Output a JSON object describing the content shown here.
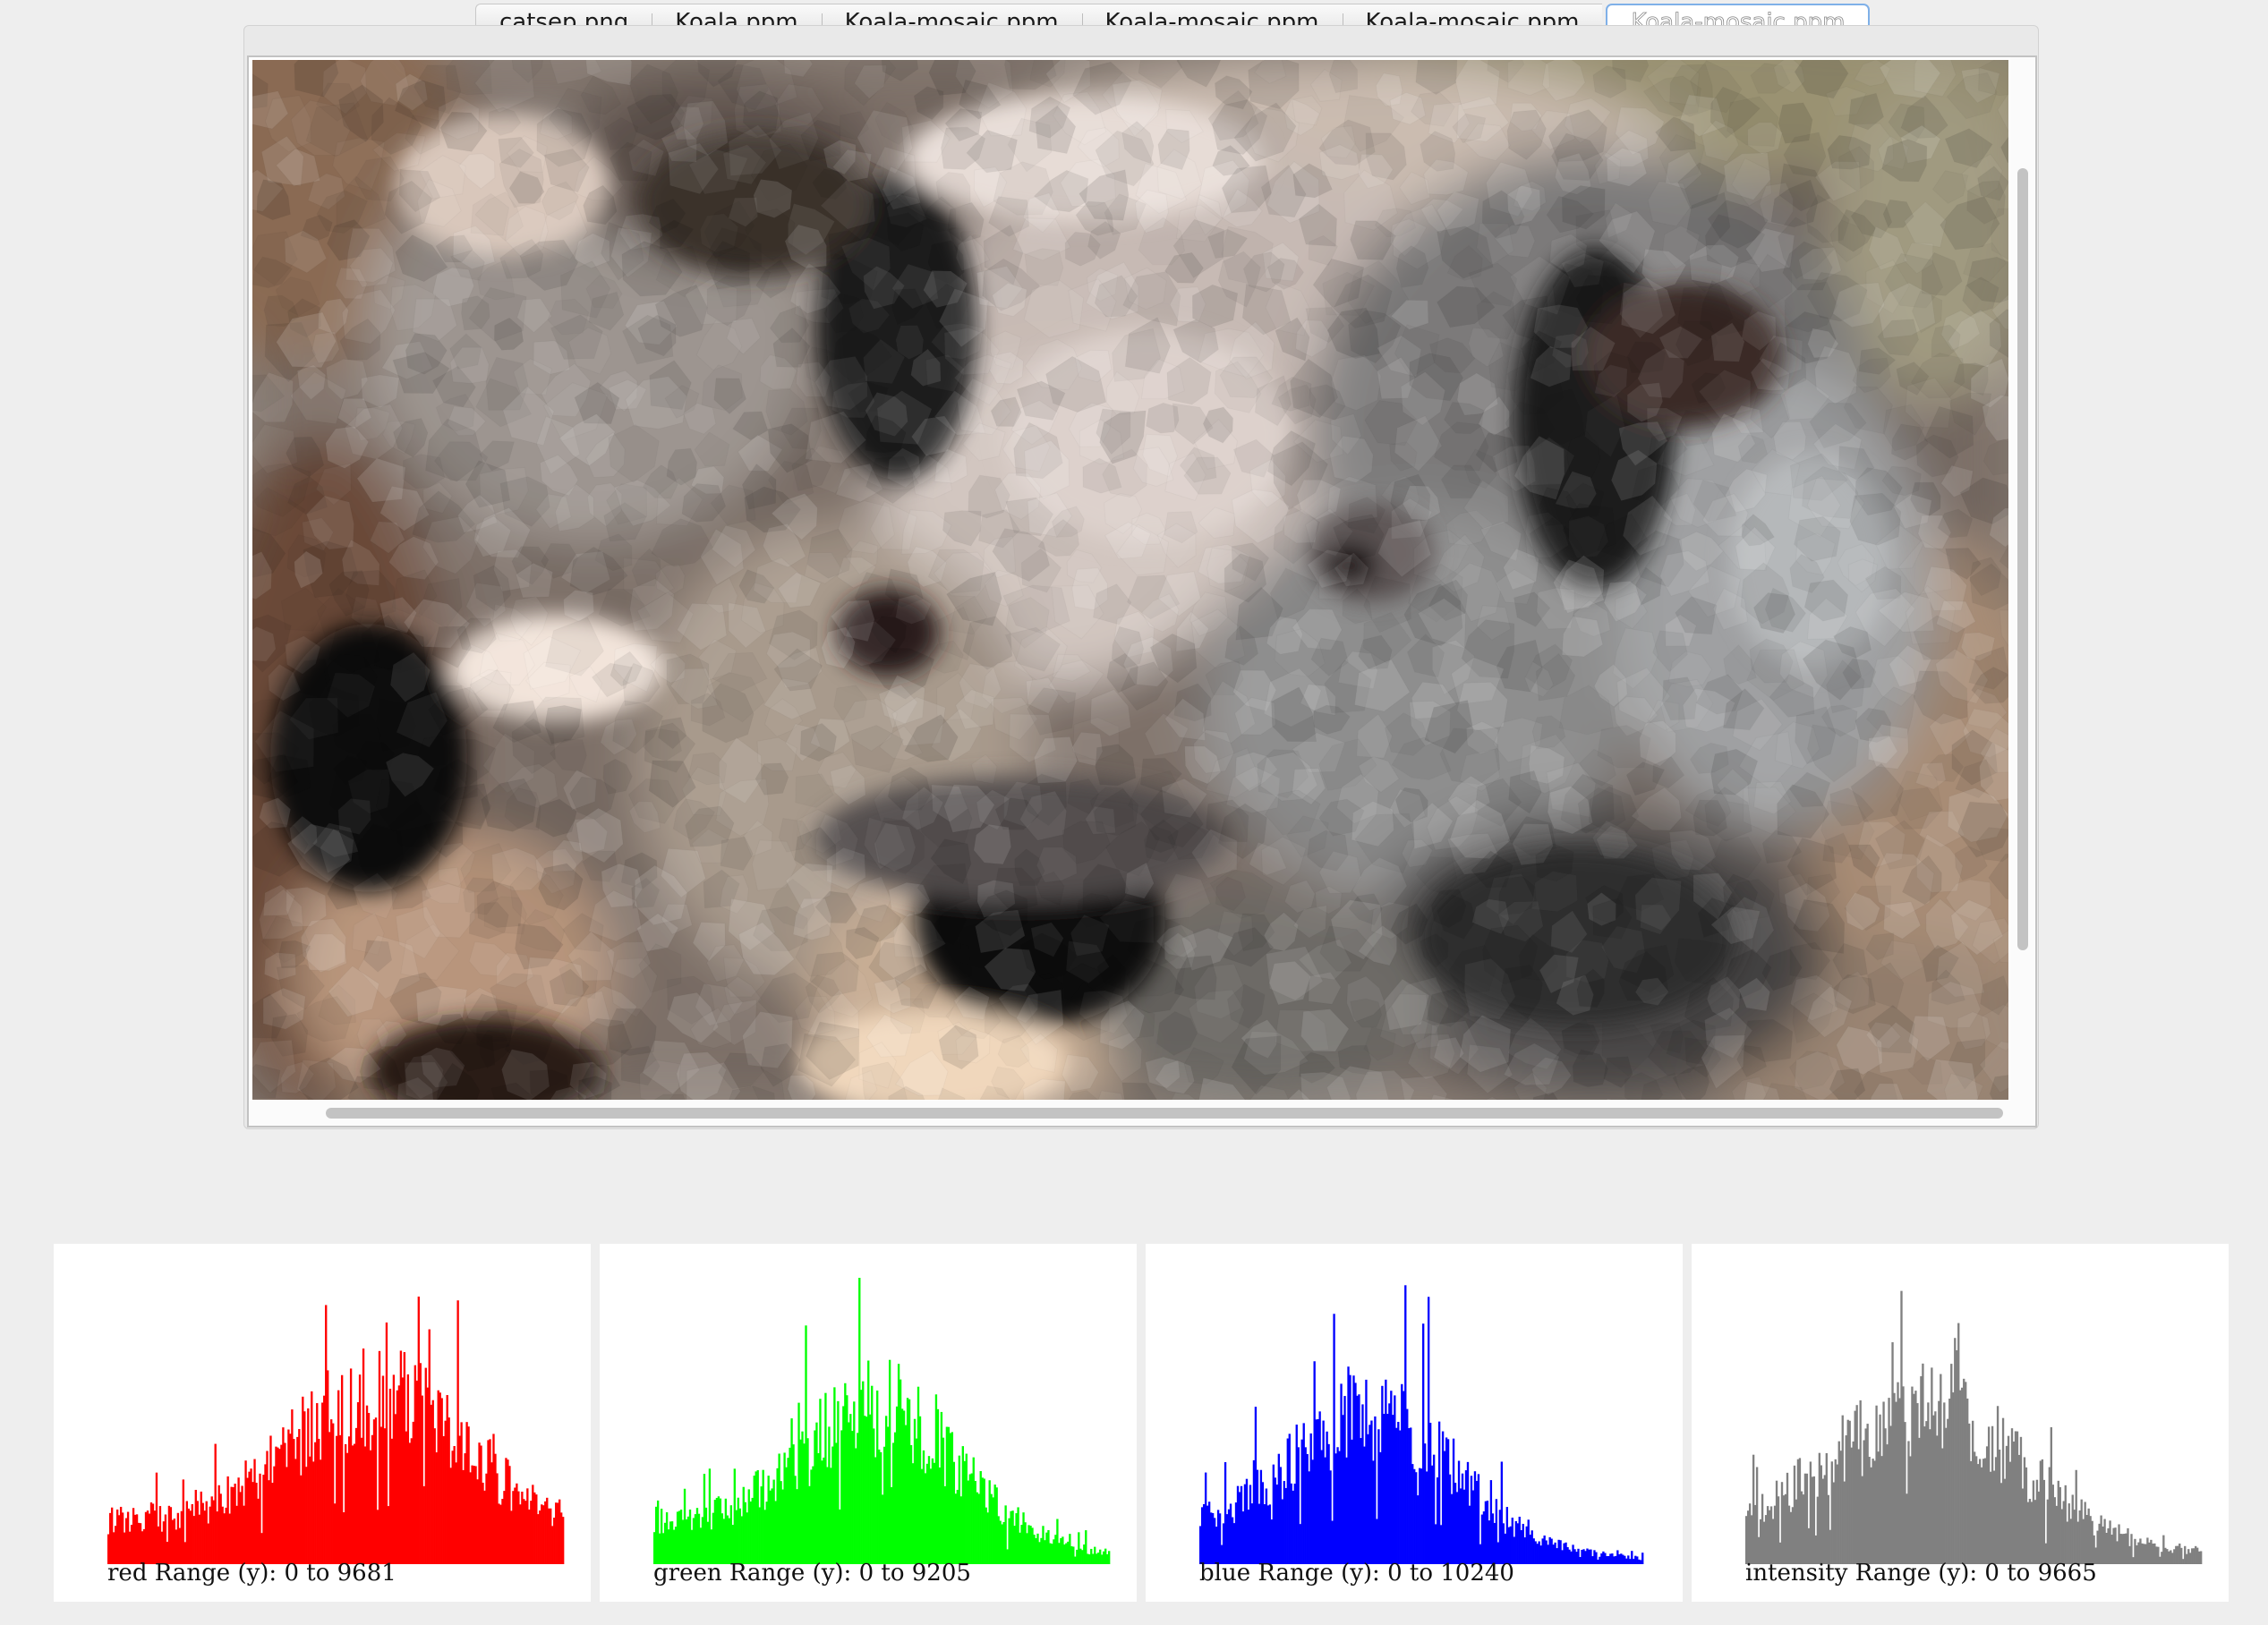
{
  "tabs": [
    {
      "label": "catsep.png",
      "active": false
    },
    {
      "label": "Koala.ppm",
      "active": false
    },
    {
      "label": "Koala-mosaic.ppm",
      "active": false
    },
    {
      "label": "Koala-mosaic.ppm",
      "active": false
    },
    {
      "label": "Koala-mosaic.ppm",
      "active": false
    },
    {
      "label": "Koala-mosaic.ppm",
      "active": true
    }
  ],
  "histograms": [
    {
      "channel": "red",
      "label": "red Range (y): 0 to 9681",
      "color": "#ff0000",
      "y_max": 9681
    },
    {
      "channel": "green",
      "label": "green Range (y): 0 to 9205",
      "color": "#00ff00",
      "y_max": 9205
    },
    {
      "channel": "blue",
      "label": "blue Range (y): 0 to 10240",
      "color": "#0000ff",
      "y_max": 10240
    },
    {
      "channel": "intensity",
      "label": "intensity Range (y): 0 to 9665",
      "color": "#808080",
      "y_max": 9665
    }
  ],
  "chart_data": [
    {
      "type": "bar",
      "series": [
        {
          "name": "red"
        }
      ],
      "x": {
        "range": [
          0,
          255
        ]
      },
      "ylim": [
        0,
        9681
      ],
      "title": "",
      "xlabel": "",
      "ylabel": "red Range (y): 0 to 9681"
    },
    {
      "type": "bar",
      "series": [
        {
          "name": "green"
        }
      ],
      "x": {
        "range": [
          0,
          255
        ]
      },
      "ylim": [
        0,
        9205
      ],
      "title": "",
      "xlabel": "",
      "ylabel": "green Range (y): 0 to 9205"
    },
    {
      "type": "bar",
      "series": [
        {
          "name": "blue"
        }
      ],
      "x": {
        "range": [
          0,
          255
        ]
      },
      "ylim": [
        0,
        10240
      ],
      "title": "",
      "xlabel": "",
      "ylabel": "blue Range (y): 0 to 10240"
    },
    {
      "type": "bar",
      "series": [
        {
          "name": "intensity"
        }
      ],
      "x": {
        "range": [
          0,
          255
        ]
      },
      "ylim": [
        0,
        9665
      ],
      "title": "",
      "xlabel": "",
      "ylabel": "intensity Range (y): 0 to 9665"
    }
  ]
}
